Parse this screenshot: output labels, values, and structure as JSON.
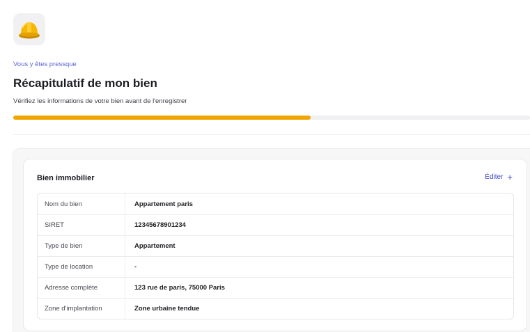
{
  "header": {
    "logo_icon": "hard-hat-icon",
    "eyebrow": "Vous y êtes pressque",
    "title": "Récapitulatif de mon bien",
    "subtitle": "Vérifiez les informations de votre bien avant de l'enregistrer"
  },
  "progress": {
    "fraction": 0.575,
    "color": "#f0a500"
  },
  "card": {
    "title": "Bien immobilier",
    "edit_label": "Éditer",
    "edit_icon": "plus-icon",
    "rows": [
      {
        "label": "Nom du bien",
        "value": "Appartement paris"
      },
      {
        "label": "SIRET",
        "value": "12345678901234"
      },
      {
        "label": "Type de bien",
        "value": "Appartement"
      },
      {
        "label": "Type de location",
        "value": "-"
      },
      {
        "label": "Adresse complète",
        "value": "123 rue de paris, 75000 Paris"
      },
      {
        "label": "Zone d'implantation",
        "value": "Zone urbaine tendue"
      }
    ]
  }
}
